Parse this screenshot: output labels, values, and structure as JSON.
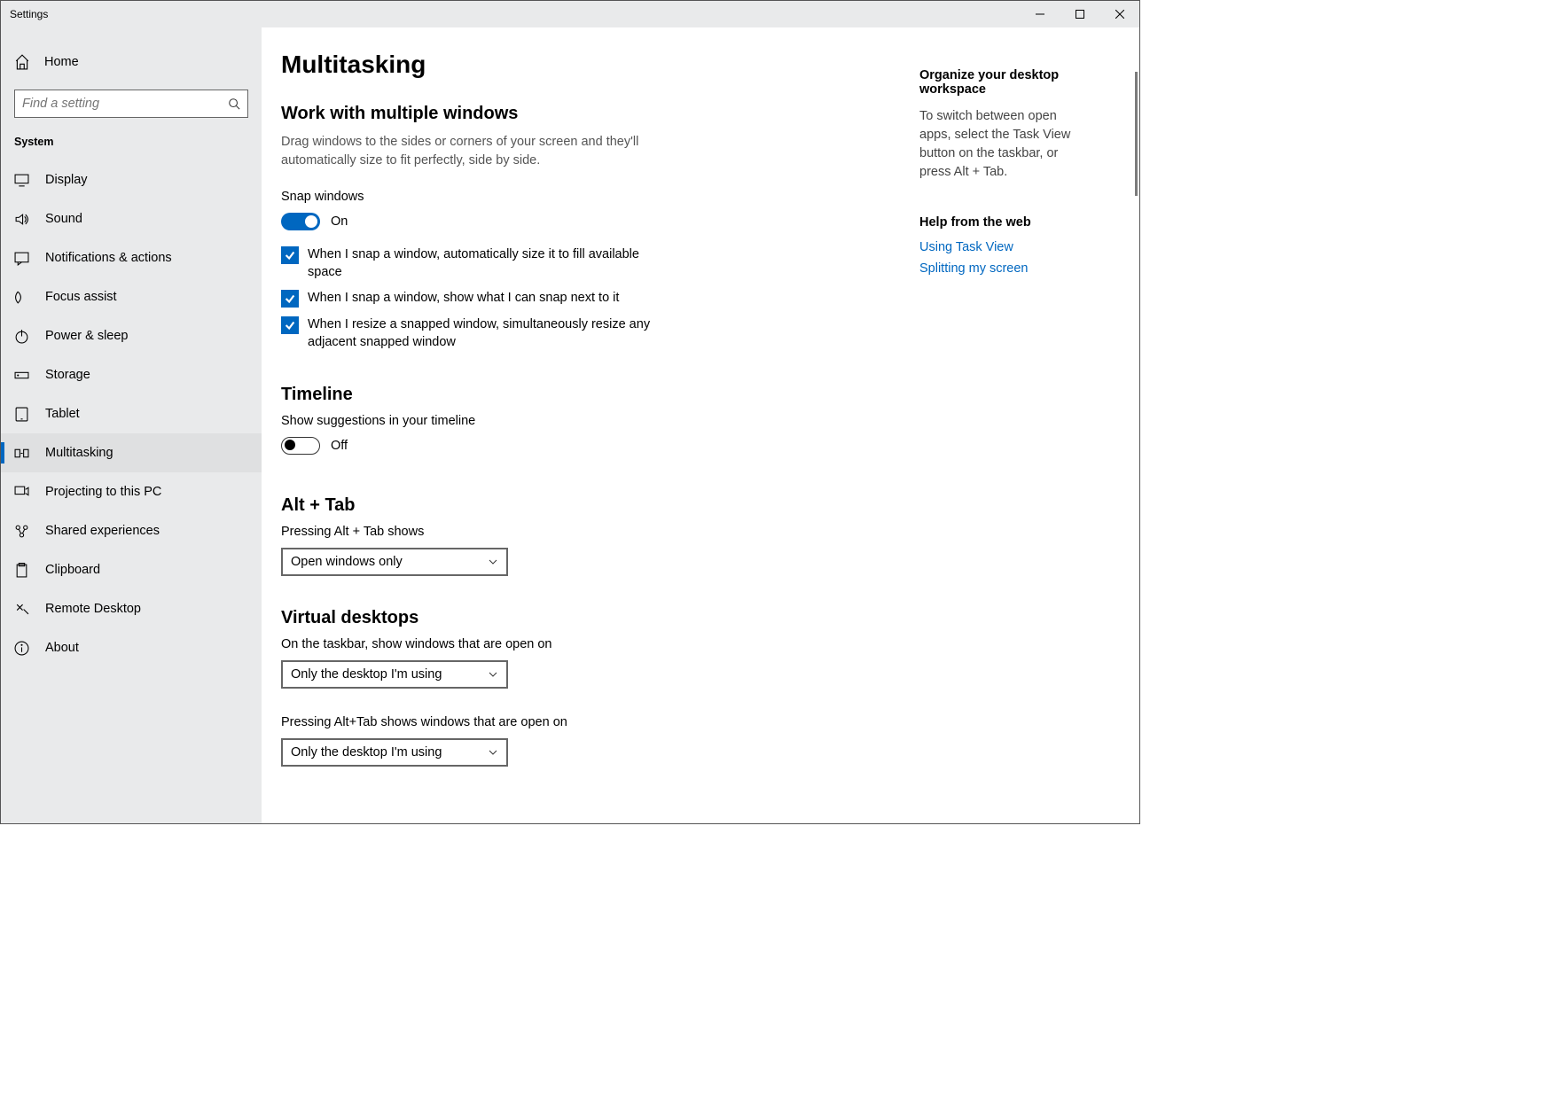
{
  "window": {
    "title": "Settings"
  },
  "sidebar": {
    "home": "Home",
    "search_placeholder": "Find a setting",
    "section": "System",
    "items": [
      {
        "label": "Display",
        "icon": "display"
      },
      {
        "label": "Sound",
        "icon": "sound"
      },
      {
        "label": "Notifications & actions",
        "icon": "notifications"
      },
      {
        "label": "Focus assist",
        "icon": "focus"
      },
      {
        "label": "Power & sleep",
        "icon": "power"
      },
      {
        "label": "Storage",
        "icon": "storage"
      },
      {
        "label": "Tablet",
        "icon": "tablet"
      },
      {
        "label": "Multitasking",
        "icon": "multitasking",
        "active": true
      },
      {
        "label": "Projecting to this PC",
        "icon": "projecting"
      },
      {
        "label": "Shared experiences",
        "icon": "shared"
      },
      {
        "label": "Clipboard",
        "icon": "clipboard"
      },
      {
        "label": "Remote Desktop",
        "icon": "remote"
      },
      {
        "label": "About",
        "icon": "about"
      }
    ]
  },
  "page": {
    "title": "Multitasking",
    "snap": {
      "heading": "Work with multiple windows",
      "description": "Drag windows to the sides or corners of your screen and they'll automatically size to fit perfectly, side by side.",
      "toggle_label": "Snap windows",
      "toggle_state": "On",
      "toggle_on": true,
      "checks": [
        "When I snap a window, automatically size it to fill available space",
        "When I snap a window, show what I can snap next to it",
        "When I resize a snapped window, simultaneously resize any adjacent snapped window"
      ]
    },
    "timeline": {
      "heading": "Timeline",
      "toggle_label": "Show suggestions in your timeline",
      "toggle_state": "Off",
      "toggle_on": false
    },
    "alttab": {
      "heading": "Alt + Tab",
      "label": "Pressing Alt + Tab shows",
      "value": "Open windows only"
    },
    "virtual": {
      "heading": "Virtual desktops",
      "label1": "On the taskbar, show windows that are open on",
      "value1": "Only the desktop I'm using",
      "label2": "Pressing Alt+Tab shows windows that are open on",
      "value2": "Only the desktop I'm using"
    }
  },
  "help": {
    "organize_heading": "Organize your desktop workspace",
    "organize_text": "To switch between open apps, select the Task View button on the taskbar, or press Alt + Tab.",
    "web_heading": "Help from the web",
    "links": [
      "Using Task View",
      "Splitting my screen"
    ]
  }
}
